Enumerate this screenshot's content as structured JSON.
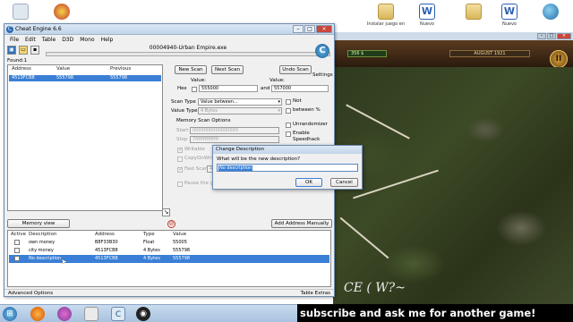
{
  "desktop": {
    "icons": [
      {
        "name": "recycle-bin-icon",
        "caption": ""
      },
      {
        "name": "app-icon-red",
        "caption": ""
      },
      {
        "name": "folder-icon",
        "caption": "Instalar juego en"
      },
      {
        "name": "word-doc-icon",
        "caption": "Nuevo"
      },
      {
        "name": "folder-icon-2",
        "caption": ""
      },
      {
        "name": "word-doc-icon-2",
        "caption": "Nuevo"
      },
      {
        "name": "dolphin-icon",
        "caption": ""
      }
    ]
  },
  "game": {
    "money": "356 $",
    "month": "AUGUST 1921",
    "pause_glyph": "II",
    "sign_text": "CE ( W?~"
  },
  "ce": {
    "title": "Cheat Engine 6.6",
    "menu": [
      "File",
      "Edit",
      "Table",
      "D3D",
      "Mono",
      "Help"
    ],
    "process": "00004940-Urban Empire.exe",
    "found": "Found:1",
    "results": {
      "headers": [
        "Address",
        "Value",
        "Previous"
      ],
      "rows": [
        {
          "address": "4513FCB8",
          "value": "555798",
          "previous": "555798"
        }
      ]
    },
    "buttons": {
      "new_scan": "New Scan",
      "next_scan": "Next Scan",
      "undo_scan": "Undo Scan",
      "settings": "Settings",
      "memory_view": "Memory view",
      "add_address": "Add Address Manually"
    },
    "scan": {
      "value_label": "Value:",
      "value_label_2": "Value:",
      "hex_label": "Hex",
      "hex_from": "555000",
      "and_label": "and",
      "hex_to": "557000",
      "scan_type_label": "Scan Type",
      "scan_type": "Value between...",
      "value_type_label": "Value Type",
      "value_type": "4 Bytes",
      "not_label": "Not",
      "between_pct_label": "between %",
      "options_title": "Memory Scan Options",
      "start_label": "Start",
      "start_value": "0000000000000000",
      "stop_label": "Stop",
      "stop_value": "7fffffffffffffff",
      "writable": "Writable",
      "copy_on_write": "CopyOnWrite",
      "fast_scan": "Fast Scan",
      "fast_scan_value": "4",
      "pause_game": "Pause the game",
      "unrandomizer": "Unrandomizer",
      "speedhack": "Enable Speedhack"
    },
    "table": {
      "headers": [
        "Active",
        "Description",
        "Address",
        "Type",
        "Value"
      ],
      "rows": [
        {
          "description": "own money",
          "address": "B8F33B30",
          "type": "Float",
          "value": "55005"
        },
        {
          "description": "city money",
          "address": "4513FCB8",
          "type": "4 Bytes",
          "value": "555798"
        },
        {
          "description": "No description",
          "address": "4513FCB8",
          "type": "4 Bytes",
          "value": "555798"
        }
      ]
    },
    "status": {
      "left": "Advanced Options",
      "right": "Table Extras"
    }
  },
  "dialog": {
    "title": "Change Description",
    "question": "What will be the new description?",
    "value": "No description",
    "ok": "OK",
    "cancel": "Cancel"
  },
  "banner": "subscribe and ask me for another game!",
  "colors": {
    "selection": "#3a7fd5",
    "banner_bg": "#000000",
    "ce_border": "#6e8bb0"
  }
}
